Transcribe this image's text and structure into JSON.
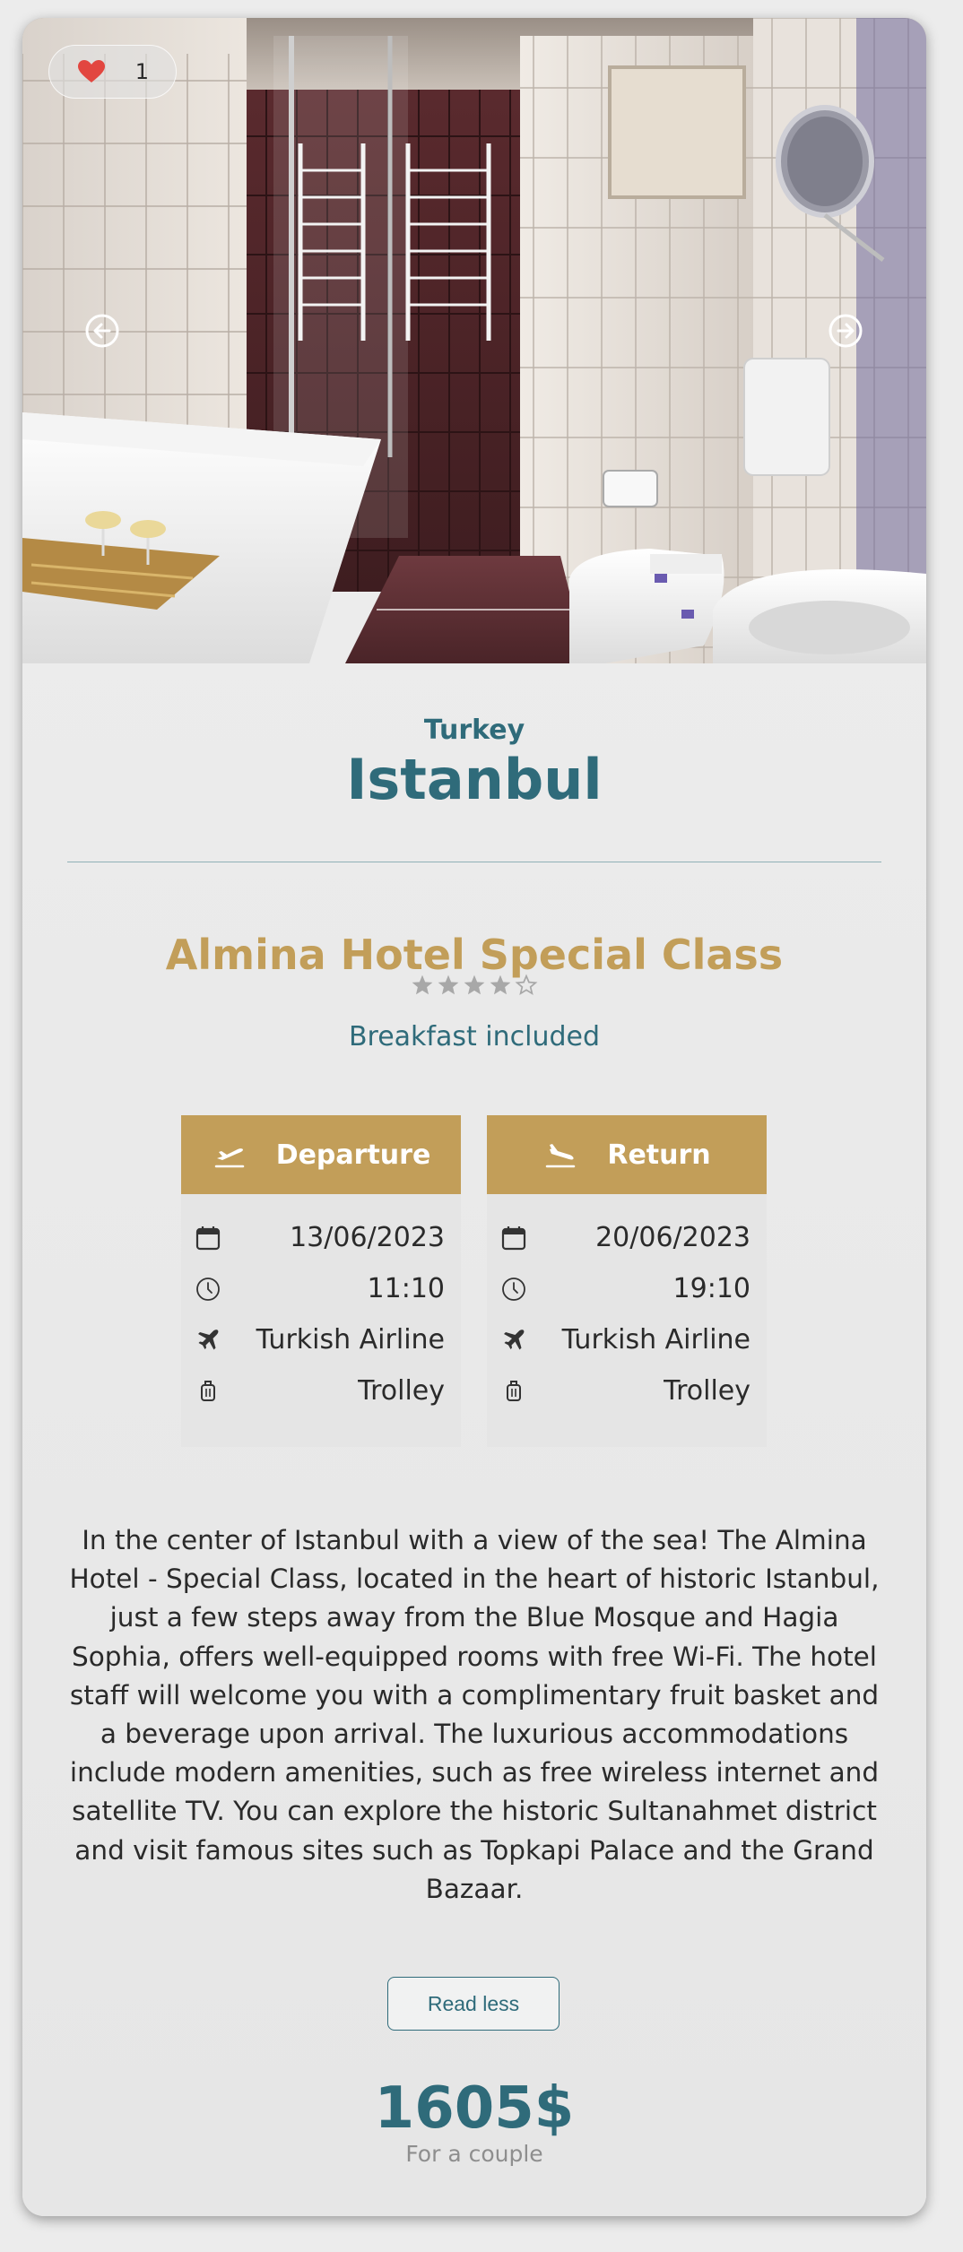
{
  "gallery": {
    "likes": "1",
    "prev_icon": "arrow-left-circle-icon",
    "next_icon": "arrow-right-circle-icon",
    "like_icon": "heart-icon"
  },
  "destination": {
    "country": "Turkey",
    "city": "Istanbul"
  },
  "hotel": {
    "name": "Almina Hotel Special Class",
    "rating": 4,
    "max_rating": 5,
    "board": "Breakfast included"
  },
  "departure": {
    "title": "Departure",
    "date": "13/06/2023",
    "time": "11:10",
    "airline": "Turkish Airline",
    "baggage": "Trolley"
  },
  "return": {
    "title": "Return",
    "date": "20/06/2023",
    "time": "19:10",
    "airline": "Turkish Airline",
    "baggage": "Trolley"
  },
  "description": "In the center of Istanbul with a view of the sea! The Almina Hotel - Special Class, located in the heart of historic Istanbul, just a few steps away from the Blue Mosque and Hagia Sophia, offers well-equipped rooms with free Wi-Fi. The hotel staff will welcome you with a complimentary fruit basket and a beverage upon arrival. The luxurious accommodations include modern amenities, such as free wireless internet and satellite TV. You can explore the historic Sultanahmet district and visit famous sites such as Topkapi Palace and the Grand Bazaar.",
  "read_toggle": "Read less",
  "price": {
    "amount": "1605$",
    "note": "For a couple"
  },
  "colors": {
    "teal": "#2f6b7a",
    "gold": "#c29e59",
    "heart": "#e2463f"
  }
}
